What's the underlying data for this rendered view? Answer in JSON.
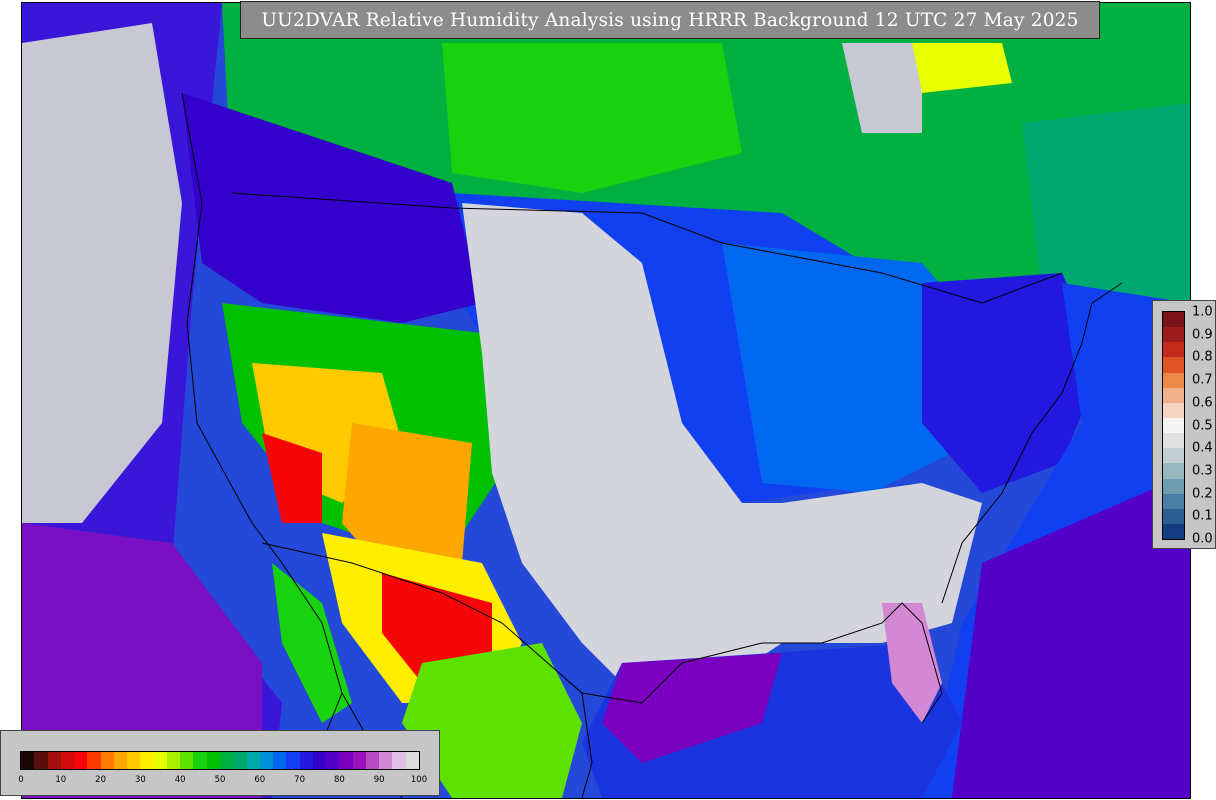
{
  "title": "UU2DVAR Relative Humidity Analysis using HRRR Background 12 UTC 27 May 2025",
  "rh_legend": {
    "ticks": [
      "0",
      "10",
      "20",
      "30",
      "40",
      "50",
      "60",
      "70",
      "80",
      "90",
      "100"
    ],
    "colors": [
      "#1a0505",
      "#5c0d0d",
      "#a10f0f",
      "#d20c0c",
      "#f60606",
      "#ff3a00",
      "#ff7a00",
      "#ffa600",
      "#ffcb00",
      "#ffee00",
      "#e8ff00",
      "#a8f000",
      "#5ee000",
      "#18d210",
      "#00c000",
      "#00b040",
      "#00a870",
      "#00a8a8",
      "#0090d8",
      "#0068f0",
      "#1040f0",
      "#2218e0",
      "#3400cc",
      "#5400c8",
      "#7a00c0",
      "#9a12bc",
      "#b84ac4",
      "#d288d2",
      "#e2c0e2",
      "#dcdcdc"
    ]
  },
  "weight_legend": {
    "ticks": [
      "1.0",
      "0.9",
      "0.8",
      "0.7",
      "0.6",
      "0.5",
      "0.4",
      "0.3",
      "0.2",
      "0.1",
      "0.0"
    ],
    "colors": [
      "#7a1418",
      "#9e1c1c",
      "#c42a1c",
      "#e05424",
      "#ee8846",
      "#f2b08a",
      "#f6d4c2",
      "#f4f4f4",
      "#e2e2e2",
      "#c2cfd2",
      "#98b8c0",
      "#6e9cb0",
      "#4a7ea4",
      "#2c5e94",
      "#143c82"
    ]
  }
}
